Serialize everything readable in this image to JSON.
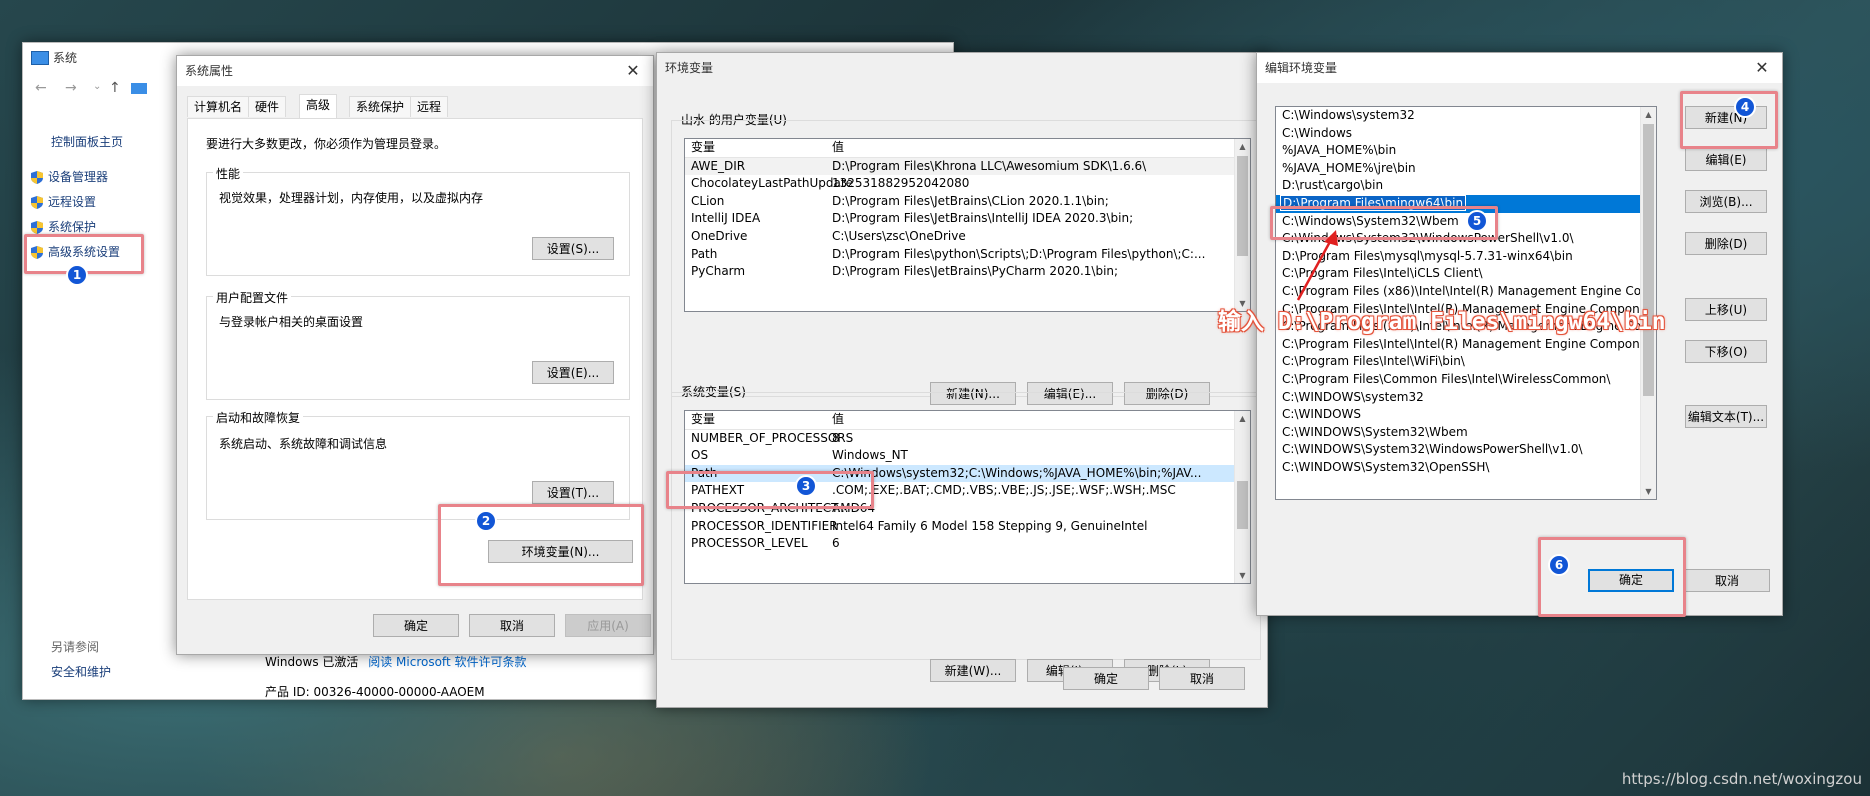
{
  "system_window": {
    "title": "系统",
    "nav_control_panel": "控制面板主页",
    "nav_items": [
      "设备管理器",
      "远程设置",
      "系统保护",
      "高级系统设置"
    ],
    "see_also_label": "另请参阅",
    "security_link": "安全和维护",
    "activation_text": "Windows 已激活",
    "license_link": "阅读 Microsoft 软件许可条款",
    "product_id": "产品 ID: 00326-40000-00000-AAOEM"
  },
  "sys_props": {
    "title": "系统属性",
    "tabs": [
      "计算机名",
      "硬件",
      "高级",
      "系统保护",
      "远程"
    ],
    "admin_note": "要进行大多数更改，你必须作为管理员登录。",
    "perf_label": "性能",
    "perf_desc": "视觉效果，处理器计划，内存使用，以及虚拟内存",
    "profile_label": "用户配置文件",
    "profile_desc": "与登录帐户相关的桌面设置",
    "startup_label": "启动和故障恢复",
    "startup_desc": "系统启动、系统故障和调试信息",
    "settings_s": "设置(S)...",
    "settings_e": "设置(E)...",
    "settings_t": "设置(T)...",
    "env_button": "环境变量(N)...",
    "ok": "确定",
    "cancel": "取消",
    "apply": "应用(A)"
  },
  "env_vars": {
    "title": "环境变量",
    "user_section": "山水 的用户变量(U)",
    "col_var": "变量",
    "col_val": "值",
    "user_rows": [
      {
        "name": "AWE_DIR",
        "value": "D:\\Program Files\\Khrona LLC\\Awesomium SDK\\1.6.6\\"
      },
      {
        "name": "ChocolateyLastPathUpdate",
        "value": "132531882952042080"
      },
      {
        "name": "CLion",
        "value": "D:\\Program Files\\JetBrains\\CLion 2020.1.1\\bin;"
      },
      {
        "name": "IntelliJ IDEA",
        "value": "D:\\Program Files\\JetBrains\\IntelliJ IDEA 2020.3\\bin;"
      },
      {
        "name": "OneDrive",
        "value": "C:\\Users\\zsc\\OneDrive"
      },
      {
        "name": "Path",
        "value": "D:\\Program Files\\python\\Scripts\\;D:\\Program Files\\python\\;C:..."
      },
      {
        "name": "PyCharm",
        "value": "D:\\Program Files\\JetBrains\\PyCharm 2020.1\\bin;"
      }
    ],
    "user_new": "新建(N)...",
    "user_edit": "编辑(E)...",
    "user_delete": "删除(D)",
    "sys_section": "系统变量(S)",
    "sys_rows": [
      {
        "name": "NUMBER_OF_PROCESSORS",
        "value": "8"
      },
      {
        "name": "OS",
        "value": "Windows_NT"
      },
      {
        "name": "Path",
        "value": "C:\\Windows\\system32;C:\\Windows;%JAVA_HOME%\\bin;%JAV..."
      },
      {
        "name": "PATHEXT",
        "value": ".COM;.EXE;.BAT;.CMD;.VBS;.VBE;.JS;.JSE;.WSF;.WSH;.MSC"
      },
      {
        "name": "PROCESSOR_ARCHITECT...",
        "value": "AMD64"
      },
      {
        "name": "PROCESSOR_IDENTIFIER",
        "value": "Intel64 Family 6 Model 158 Stepping 9, GenuineIntel"
      },
      {
        "name": "PROCESSOR_LEVEL",
        "value": "6"
      }
    ],
    "sys_new": "新建(W)...",
    "sys_edit": "编辑(I)...",
    "sys_delete": "删除(L)",
    "ok": "确定",
    "cancel": "取消"
  },
  "edit_env": {
    "title": "编辑环境变量",
    "entries": [
      "C:\\Windows\\system32",
      "C:\\Windows",
      "%JAVA_HOME%\\bin",
      "%JAVA_HOME%\\jre\\bin",
      "D:\\rust\\cargo\\bin",
      "D:\\Program Files\\mingw64\\bin",
      "C:\\Windows\\System32\\Wbem",
      "C:\\Windows\\System32\\WindowsPowerShell\\v1.0\\",
      "D:\\Program Files\\mysql\\mysql-5.7.31-winx64\\bin",
      "C:\\Program Files\\Intel\\iCLS Client\\",
      "C:\\Program Files (x86)\\Intel\\Intel(R) Management Engine Co...",
      "C:\\Program Files\\Intel\\Intel(R) Management Engine Compon...",
      "C:\\Program Files (x86)\\Intel\\Intel(R) Management Engine Co...",
      "C:\\Program Files\\Intel\\Intel(R) Management Engine Compon...",
      "C:\\Program Files\\Intel\\WiFi\\bin\\",
      "C:\\Program Files\\Common Files\\Intel\\WirelessCommon\\",
      "C:\\WINDOWS\\system32",
      "C:\\WINDOWS",
      "C:\\WINDOWS\\System32\\Wbem",
      "C:\\WINDOWS\\System32\\WindowsPowerShell\\v1.0\\",
      "C:\\WINDOWS\\System32\\OpenSSH\\"
    ],
    "buttons": {
      "new": "新建(N)",
      "edit": "编辑(E)",
      "browse": "浏览(B)...",
      "delete": "删除(D)",
      "move_up": "上移(U)",
      "move_down": "下移(O)",
      "edit_text": "编辑文本(T)..."
    },
    "ok": "确定",
    "cancel": "取消"
  },
  "annotation": {
    "text": "输入 D:\\Program Files\\mingw64\\bin",
    "steps": [
      "1",
      "2",
      "3",
      "4",
      "5",
      "6"
    ]
  },
  "watermark": "https://blog.csdn.net/woxingzou",
  "colors": {
    "selection": "#0078d7",
    "highlight_box": "#e8838a",
    "badge": "#1256d6",
    "annotation_text": "#ffffff",
    "link": "#0066cc"
  }
}
